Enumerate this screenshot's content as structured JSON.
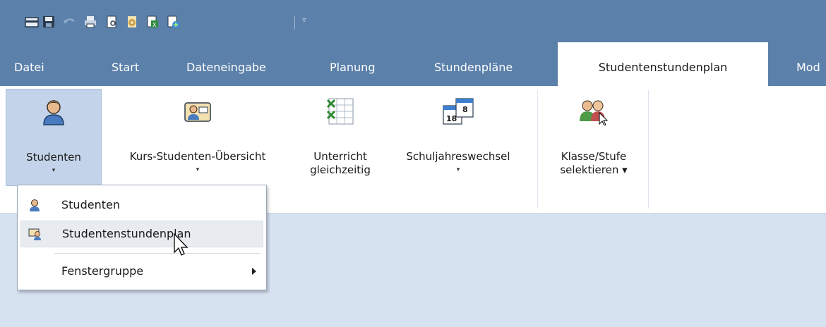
{
  "quick_access": {
    "icons": [
      "folder-open-icon",
      "save-icon",
      "undo-icon",
      "print-icon",
      "print-preview-icon",
      "settings-icon",
      "excel-export-icon",
      "html-export-icon"
    ],
    "customize_label": "▿"
  },
  "tabs": [
    {
      "label": "Datei"
    },
    {
      "label": "Start"
    },
    {
      "label": "Dateneingabe"
    },
    {
      "label": "Planung"
    },
    {
      "label": "Stundenpläne"
    },
    {
      "label": "Studentenstundenplan"
    },
    {
      "label": "Mod"
    }
  ],
  "ribbon": {
    "buttons": [
      {
        "label": "Studenten",
        "arrow": "▾"
      },
      {
        "label": "Kurs-Studenten-Übersicht",
        "arrow": "▾"
      },
      {
        "label1": "Unterricht",
        "label2": "gleichzeitig"
      },
      {
        "label": "Schuljahreswechsel",
        "arrow": "▾",
        "icon_text_a": "18",
        "icon_text_b": "8"
      },
      {
        "label1": "Klasse/Stufe",
        "label2": "selektieren ▾"
      }
    ]
  },
  "dropdown": {
    "items": [
      {
        "label": "Studenten"
      },
      {
        "label": "Studentenstundenplan"
      },
      {
        "label": "Fenstergruppe"
      }
    ]
  },
  "colors": {
    "title_bar": "#5b80a9",
    "ribbon": "#ffffff",
    "workspace": "#d6e2f0",
    "pressed": "#c3d4ea"
  }
}
